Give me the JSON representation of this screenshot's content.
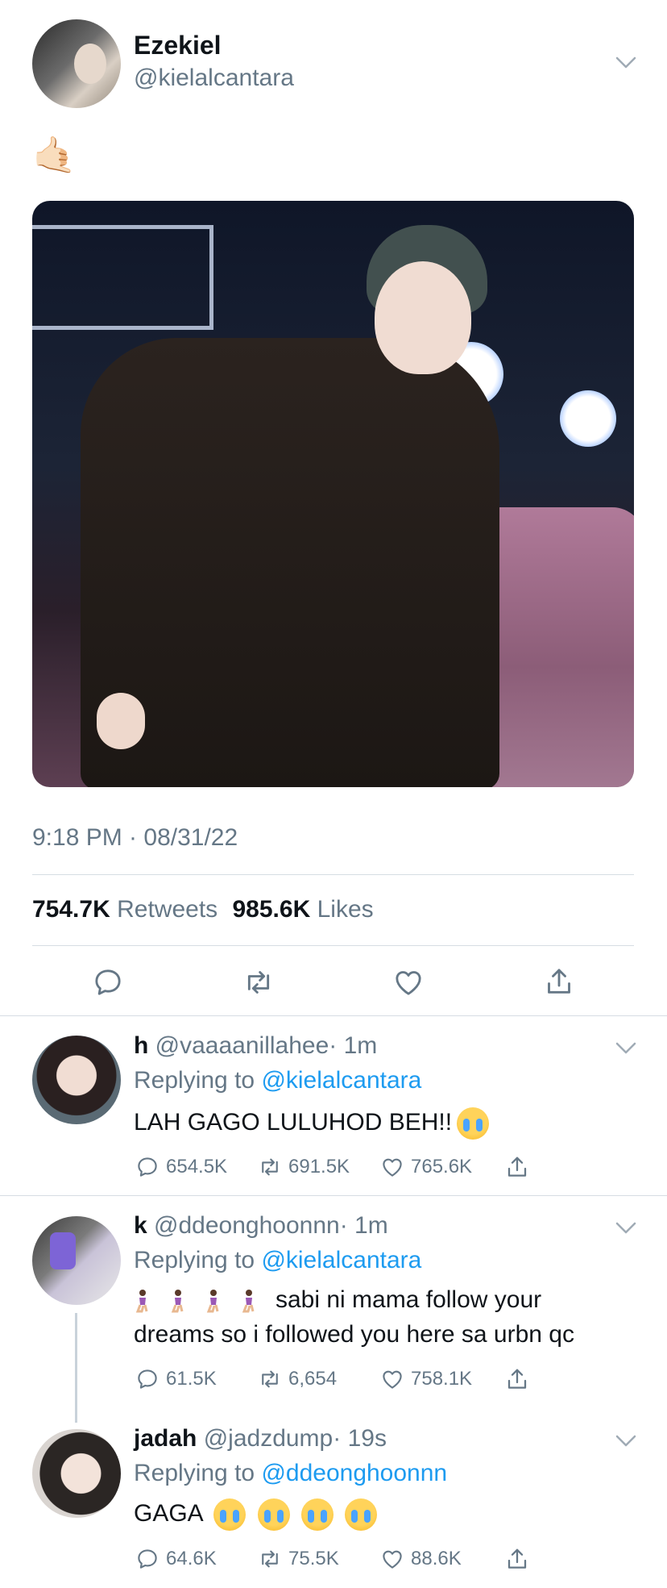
{
  "main_tweet": {
    "display_name": "Ezekiel",
    "handle": "@kielalcantara",
    "emoji": "🤙🏻",
    "time": "9:18 PM · 08/31/22",
    "retweets_count": "754.7K",
    "retweets_label": "Retweets",
    "likes_count": "985.6K",
    "likes_label": "Likes"
  },
  "replies": [
    {
      "name": "h",
      "handle": "@vaaaanillahee",
      "time": "· 1m",
      "replying_prefix": "Replying to",
      "replying_to": "@kielalcantara",
      "text": "LAH GAGO LULUHOD BEH!!",
      "replies": "654.5K",
      "retweets": "691.5K",
      "likes": "765.6K"
    },
    {
      "name": "k",
      "handle": "@ddeonghoonnn",
      "time": "· 1m",
      "replying_prefix": "Replying to",
      "replying_to": "@kielalcantara",
      "text_line1": "sabi ni mama follow your",
      "text_line2": "dreams so i followed you here sa urbn qc",
      "replies": "61.5K",
      "retweets": "6,654",
      "likes": "758.1K"
    },
    {
      "name": "jadah",
      "handle": "@jadzdump",
      "time": "· 19s",
      "replying_prefix": "Replying to",
      "replying_to": "@ddeonghoonnn",
      "text": "GAGA",
      "replies": "64.6K",
      "retweets": "75.5K",
      "likes": "88.6K"
    }
  ],
  "colors": {
    "accent": "#1d9bf0",
    "muted": "#657786",
    "divider": "#d6dde3"
  },
  "icons": [
    "chevron-down-icon",
    "reply-icon",
    "retweet-icon",
    "like-icon",
    "share-icon"
  ]
}
